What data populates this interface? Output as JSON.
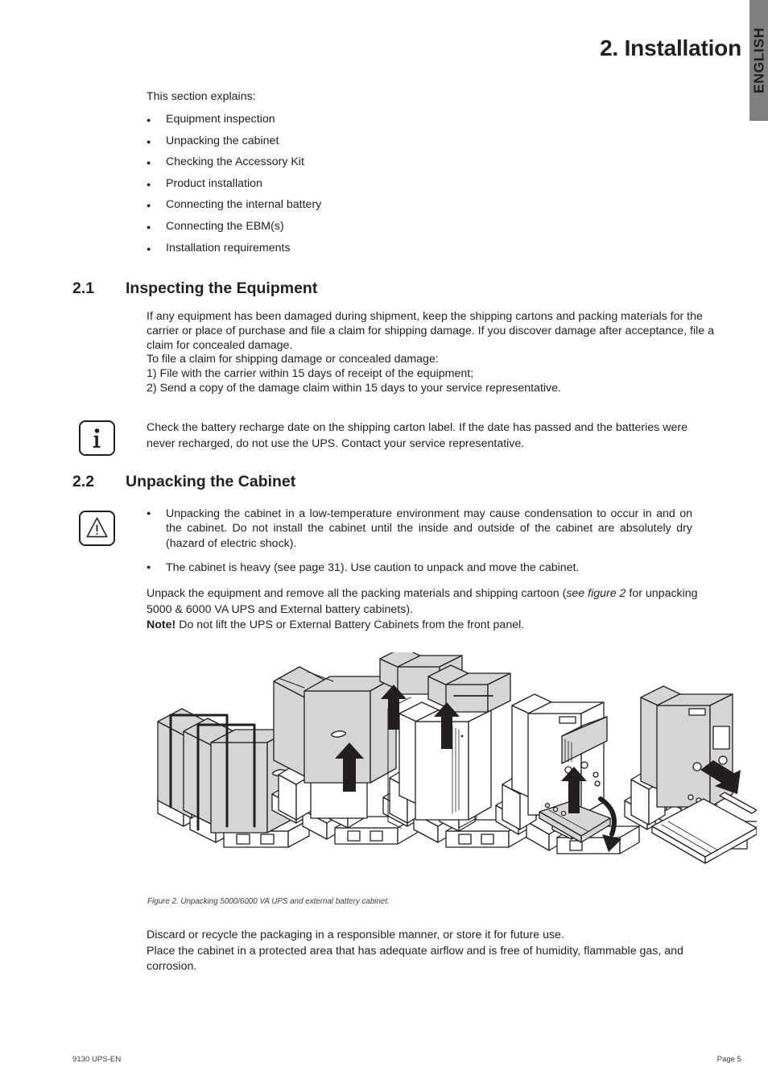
{
  "side_tab": {
    "label": "ENGLISH",
    "bg_color": "#808080"
  },
  "chapter": {
    "title": "2. Installation"
  },
  "intro": {
    "lead": "This section explains:"
  },
  "intro_bullets": [
    {
      "label": "Equipment inspection"
    },
    {
      "label": "Unpacking the cabinet"
    },
    {
      "label": "Checking the Accessory Kit"
    },
    {
      "label": "Product installation"
    },
    {
      "label": "Connecting the internal battery"
    },
    {
      "label": "Connecting the EBM(s)"
    },
    {
      "label": "Installation requirements"
    }
  ],
  "section_21": {
    "number": "2.1",
    "title": "Inspecting the Equipment",
    "para1": "If any equipment has been damaged during shipment, keep the shipping cartons and packing materials for the carrier or place of purchase and file a claim for shipping damage. If you discover damage after acceptance, file a claim for concealed damage.",
    "para2": "To file a claim for shipping damage or concealed damage:",
    "para3": "1) File with the carrier within 15 days of receipt of the equipment;",
    "para4": "2) Send a copy of the damage claim within 15 days to your service representative."
  },
  "info_note": {
    "icon": "information-icon",
    "text": "Check the battery recharge date on the shipping carton label. If the date has passed and the batteries were never recharged, do not use the UPS. Contact your service representative."
  },
  "section_22": {
    "number": "2.2",
    "title": "Unpacking the Cabinet",
    "warning_icon": "warning-triangle-icon",
    "warning_bullets": [
      {
        "label": "Unpacking the cabinet in a low-temperature environment may cause condensation to occur in and on the cabinet. Do not install the cabinet until the inside and outside of the cabinet are absolutely dry (hazard of electric shock)."
      },
      {
        "label": "The cabinet is heavy (see page 31). Use caution to unpack and move the cabinet."
      }
    ],
    "unpack_line1_a": "Unpack the equipment and remove all the packing materials and shipping cartoon (",
    "unpack_line1_italic": "see figure 2",
    "unpack_line1_b": " for unpacking 5000 & 6000 VA UPS and External battery cabinets).",
    "note_label": "Note!",
    "note_body": " Do not lift the UPS or External Battery Cabinets from the front panel."
  },
  "figure": {
    "caption": "Figure 2. Unpacking 5000/6000 VA UPS and external battery cabinet.",
    "alt": "Five-step isometric line drawing showing a packaged UPS cabinet on a pallet, removal of the outer carton, removal of the top foam blocks, removal of the front panel, and the cabinet being rolled down a ramp off the pallet.",
    "fill_color": "#d5d5d5",
    "line_color": "#231f20"
  },
  "closing": {
    "line1": "Discard or recycle the packaging in a responsible manner, or store it for future use.",
    "line2": "Place the cabinet in a protected area that has adequate airflow and is free of humidity, flammable gas, and corrosion."
  },
  "footer": {
    "left": "9130 UPS-EN",
    "right": "Page 5"
  }
}
